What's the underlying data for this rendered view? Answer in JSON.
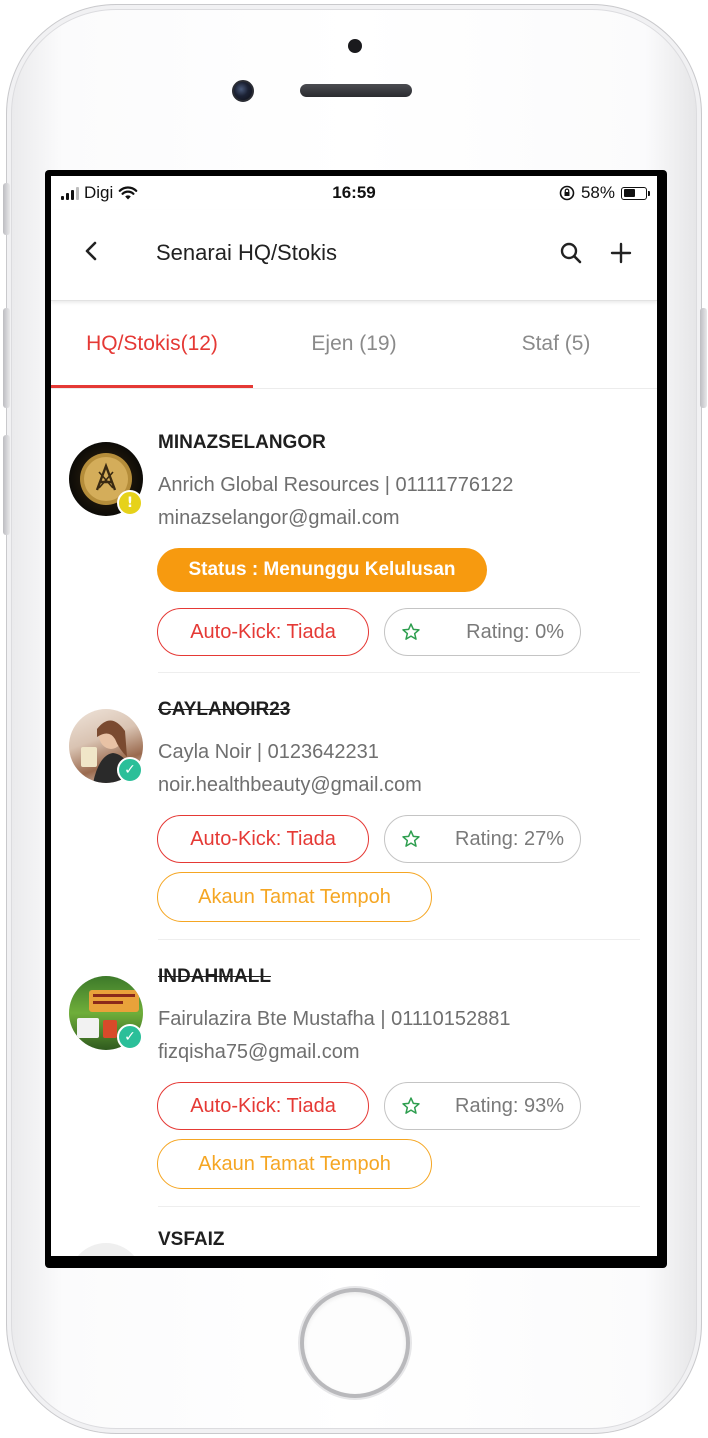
{
  "status_bar": {
    "carrier": "Digi",
    "time": "16:59",
    "battery": "58%",
    "battery_level": 0.58,
    "signal_bars": 3
  },
  "header": {
    "title": "Senarai HQ/Stokis",
    "back_icon": "chevron-left-icon",
    "search_icon": "search-icon",
    "add_icon": "plus-icon"
  },
  "tabs": [
    {
      "label": "HQ/Stokis(12)",
      "active": true
    },
    {
      "label": "Ejen (19)",
      "active": false
    },
    {
      "label": "Staf (5)",
      "active": false
    }
  ],
  "colors": {
    "accent": "#e53935",
    "status_orange": "#f79a0f",
    "expired_orange": "#f5a623",
    "verified_green": "#2bbf99",
    "pending_yellow": "#e6d21a",
    "star_green": "#2e9e4f"
  },
  "items": [
    {
      "username": "MINAZSELANGOR",
      "strikethrough": false,
      "info_line": "Anrich Global Resources | 01111776122",
      "email": "minazselangor@gmail.com",
      "badge": "warning",
      "status": "Status : Menunggu Kelulusan",
      "auto_kick": "Auto-Kick: Tiada",
      "rating": "Rating: 0%",
      "expired": null
    },
    {
      "username": "CAYLANOIR23",
      "strikethrough": true,
      "info_line": "Cayla Noir | 0123642231",
      "email": "noir.healthbeauty@gmail.com",
      "badge": "verified",
      "status": null,
      "auto_kick": "Auto-Kick: Tiada",
      "rating": "Rating: 27%",
      "expired": "Akaun Tamat Tempoh"
    },
    {
      "username": "INDAHMALL",
      "strikethrough": true,
      "info_line": "Fairulazira Bte Mustafha | 01110152881",
      "email": "fizqisha75@gmail.com",
      "badge": "verified",
      "status": null,
      "auto_kick": "Auto-Kick: Tiada",
      "rating": "Rating: 93%",
      "expired": "Akaun Tamat Tempoh"
    },
    {
      "username": "VSFAIZ"
    }
  ]
}
